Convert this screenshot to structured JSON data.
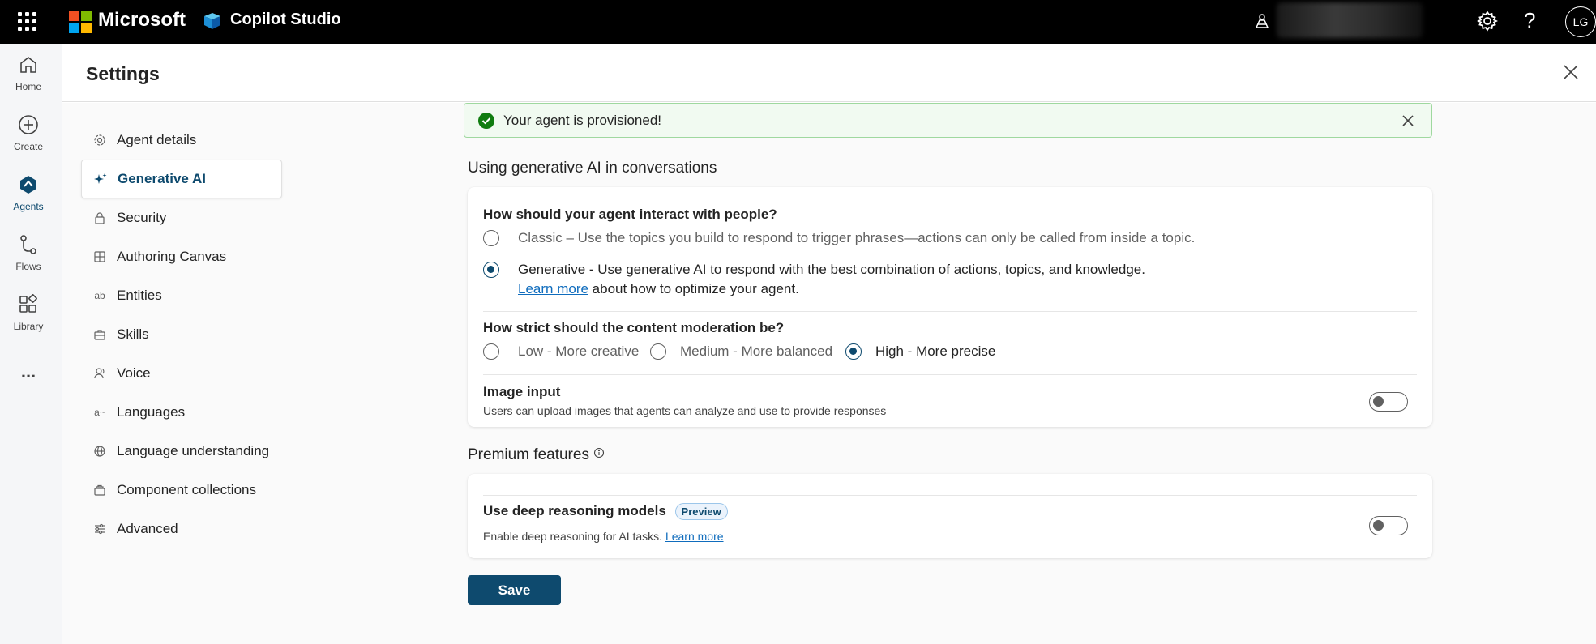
{
  "topbar": {
    "brand": "Microsoft",
    "product": "Copilot Studio",
    "avatar_initials": "LG"
  },
  "rail": {
    "items": [
      {
        "label": "Home",
        "icon": "home-icon"
      },
      {
        "label": "Create",
        "icon": "plus-circle-icon"
      },
      {
        "label": "Agents",
        "icon": "agents-icon"
      },
      {
        "label": "Flows",
        "icon": "flows-icon"
      },
      {
        "label": "Library",
        "icon": "library-icon"
      }
    ],
    "more": "..."
  },
  "settings": {
    "title": "Settings",
    "nav": [
      {
        "label": "Agent details",
        "icon": "gear-icon"
      },
      {
        "label": "Generative AI",
        "icon": "sparkle-icon"
      },
      {
        "label": "Security",
        "icon": "lock-icon"
      },
      {
        "label": "Authoring Canvas",
        "icon": "grid-icon"
      },
      {
        "label": "Entities",
        "icon": "entities-icon"
      },
      {
        "label": "Skills",
        "icon": "briefcase-icon"
      },
      {
        "label": "Voice",
        "icon": "voice-icon"
      },
      {
        "label": "Languages",
        "icon": "languages-icon"
      },
      {
        "label": "Language understanding",
        "icon": "globe-icon"
      },
      {
        "label": "Component collections",
        "icon": "collection-icon"
      },
      {
        "label": "Advanced",
        "icon": "sliders-icon"
      }
    ],
    "active_nav": "Generative AI"
  },
  "banner": {
    "text": "Your agent is provisioned!"
  },
  "genai": {
    "section_title": "Using generative AI in conversations",
    "interact_question": "How should your agent interact with people?",
    "classic_option": "Classic – Use the topics you build to respond to trigger phrases—actions can only be called from inside a topic.",
    "generative_option": "Generative - Use generative AI to respond with the best combination of actions, topics, and knowledge.",
    "learn_more": "Learn more",
    "learn_more_suffix": "about how to optimize your agent.",
    "moderation_question": "How strict should the content moderation be?",
    "moderation_options": [
      "Low - More creative",
      "Medium - More balanced",
      "High - More precise"
    ],
    "moderation_selected": "High - More precise",
    "image_input_title": "Image input",
    "image_input_desc": "Users can upload images that agents can analyze and use to provide responses",
    "image_input_on": false
  },
  "premium": {
    "section_title": "Premium features",
    "deep_title": "Use deep reasoning models",
    "deep_badge": "Preview",
    "deep_desc": "Enable deep reasoning for AI tasks.",
    "deep_learn_more": "Learn more",
    "deep_on": false
  },
  "actions": {
    "save_label": "Save"
  },
  "colors": {
    "accent": "#0e4a6e",
    "success": "#107c10",
    "link": "#0f6cbd"
  }
}
